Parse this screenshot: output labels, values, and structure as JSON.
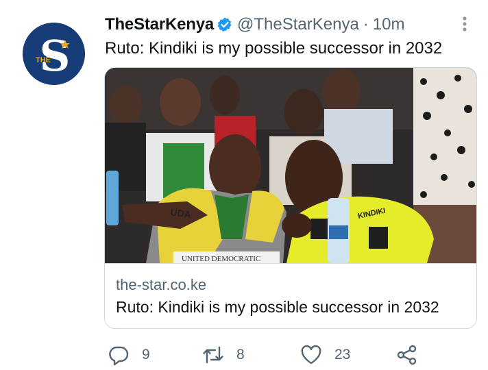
{
  "tweet": {
    "author_name": "TheStarKenya",
    "handle": "@TheStarKenya",
    "separator": "·",
    "time": "10m",
    "text": "Ruto: Kindiki is my possible successor in 2032",
    "avatar_logo": {
      "letter": "S",
      "small_text": "THE",
      "bg_color": "#163d78",
      "star_color": "#f2a516"
    },
    "verified_color": "#1d9bf0"
  },
  "card": {
    "domain": "the-star.co.ke",
    "title": "Ruto: Kindiki is my possible successor in 2032",
    "image_alt": "Two men in yellow shirts conversing at a meeting",
    "image_text": {
      "shirt_left": "UDA",
      "shirt_right": "KINDIKI",
      "table_sign": "UNITED DEMOCRATIC"
    }
  },
  "actions": {
    "reply_count": "9",
    "retweet_count": "8",
    "like_count": "23",
    "icons": [
      "reply-icon",
      "retweet-icon",
      "like-icon",
      "share-icon"
    ]
  }
}
